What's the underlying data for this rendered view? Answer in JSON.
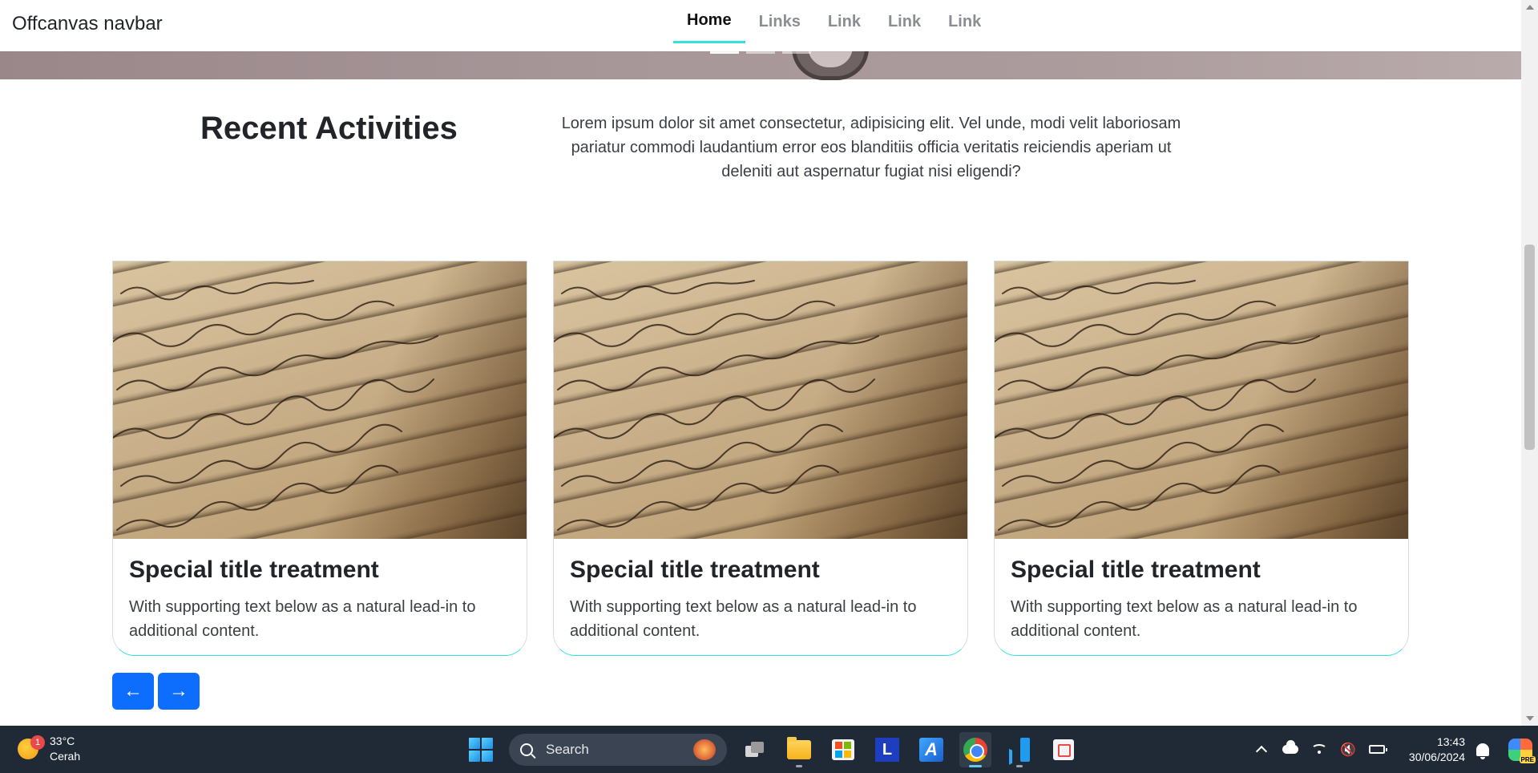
{
  "navbar": {
    "brand": "Offcanvas navbar",
    "links": [
      {
        "label": "Home",
        "active": true
      },
      {
        "label": "Links",
        "active": false
      },
      {
        "label": "Link",
        "active": false
      },
      {
        "label": "Link",
        "active": false
      },
      {
        "label": "Link",
        "active": false
      }
    ],
    "accent_color": "#35e0e0"
  },
  "section": {
    "title": "Recent Activities",
    "description": "Lorem ipsum dolor sit amet consectetur, adipisicing elit. Vel unde, modi velit laboriosam pariatur commodi laudantium error eos blanditiis officia veritatis reiciendis aperiam ut deleniti aut aspernatur fugiat nisi eligendi?"
  },
  "cards": [
    {
      "title": "Special title treatment",
      "text": "With supporting text below as a natural lead-in to additional content.",
      "image": "handwritten-letter-photo"
    },
    {
      "title": "Special title treatment",
      "text": "With supporting text below as a natural lead-in to additional content.",
      "image": "handwritten-letter-photo"
    },
    {
      "title": "Special title treatment",
      "text": "With supporting text below as a natural lead-in to additional content.",
      "image": "handwritten-letter-photo"
    }
  ],
  "carousel_controls": {
    "prev_icon": "←",
    "next_icon": "→",
    "button_color": "#0d6efd"
  },
  "taskbar": {
    "weather": {
      "temperature": "33°C",
      "condition": "Cerah",
      "badge": "1"
    },
    "search_label": "Search",
    "apps": [
      "task-view",
      "file-explorer",
      "microsoft-store",
      "l-app",
      "a-app",
      "chrome",
      "vscode",
      "snipping-tool"
    ],
    "active_app": "chrome",
    "clock": {
      "time": "13:43",
      "date": "30/06/2024"
    },
    "copilot_badge": "PRE"
  }
}
